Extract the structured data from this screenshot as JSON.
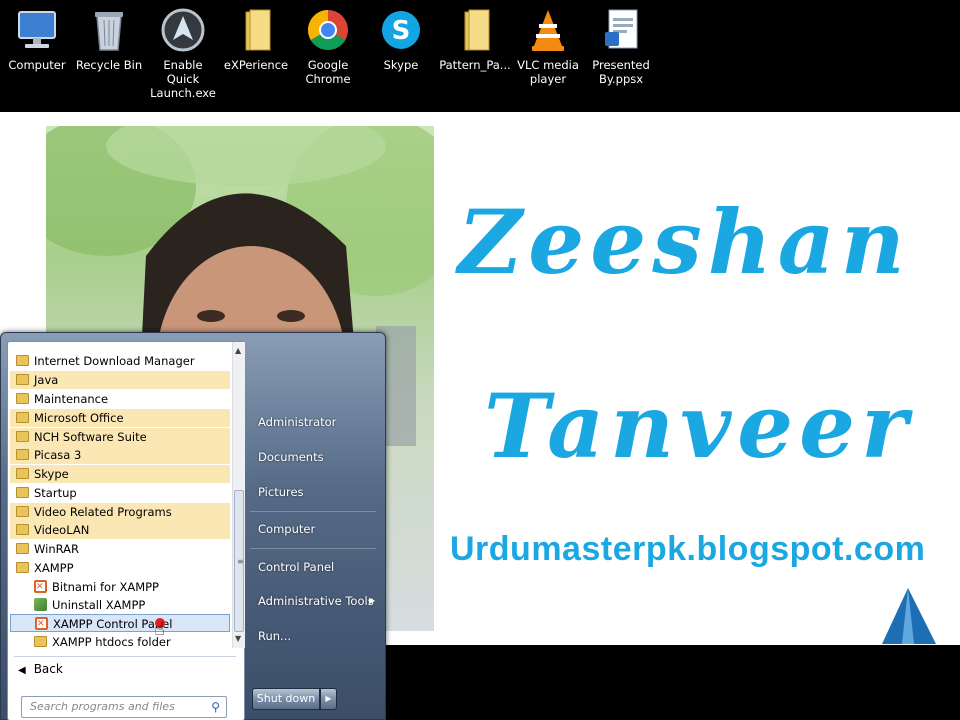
{
  "desktop_icons": [
    {
      "label": "Computer",
      "icon": "computer-icon"
    },
    {
      "label": "Recycle Bin",
      "icon": "recycle-bin-icon"
    },
    {
      "label": "Enable Quick\nLaunch.exe",
      "icon": "quick-launch-icon"
    },
    {
      "label": "eXPerience",
      "icon": "folder-icon"
    },
    {
      "label": "Google\nChrome",
      "icon": "chrome-icon"
    },
    {
      "label": "Skype",
      "icon": "skype-icon"
    },
    {
      "label": "Pattern_Pa...",
      "icon": "folder-icon"
    },
    {
      "label": "VLC media\nplayer",
      "icon": "vlc-icon"
    },
    {
      "label": "Presented\nBy.ppsx",
      "icon": "ppsx-icon"
    }
  ],
  "wallpaper": {
    "name_first": "Zeeshan",
    "name_last": "Tanveer",
    "blog": "Urdumasterpk.blogspot.com",
    "accent_color": "#1ba8e2"
  },
  "start_menu": {
    "programs": [
      {
        "label": "Internet Download Manager",
        "highlight": false
      },
      {
        "label": "Java",
        "highlight": true
      },
      {
        "label": "Maintenance",
        "highlight": false
      },
      {
        "label": "Microsoft Office",
        "highlight": true
      },
      {
        "label": "NCH Software Suite",
        "highlight": true
      },
      {
        "label": "Picasa 3",
        "highlight": true
      },
      {
        "label": "Skype",
        "highlight": true
      },
      {
        "label": "Startup",
        "highlight": false
      },
      {
        "label": "Video Related Programs",
        "highlight": true
      },
      {
        "label": "VideoLAN",
        "highlight": true
      },
      {
        "label": "WinRAR",
        "highlight": false
      },
      {
        "label": "XAMPP",
        "highlight": false
      }
    ],
    "xampp_items": [
      {
        "label": "Bitnami for XAMPP"
      },
      {
        "label": "Uninstall XAMPP"
      },
      {
        "label": "XAMPP Control Panel"
      },
      {
        "label": "XAMPP htdocs folder"
      }
    ],
    "back_label": "Back",
    "search_placeholder": "Search programs and files",
    "right_links": [
      {
        "label": "Administrator"
      },
      {
        "label": "Documents"
      },
      {
        "label": "Pictures"
      },
      {
        "label": "Computer"
      },
      {
        "label": "Control Panel"
      },
      {
        "label": "Administrative Tools"
      },
      {
        "label": "Run..."
      }
    ],
    "shutdown_label": "Shut down"
  }
}
